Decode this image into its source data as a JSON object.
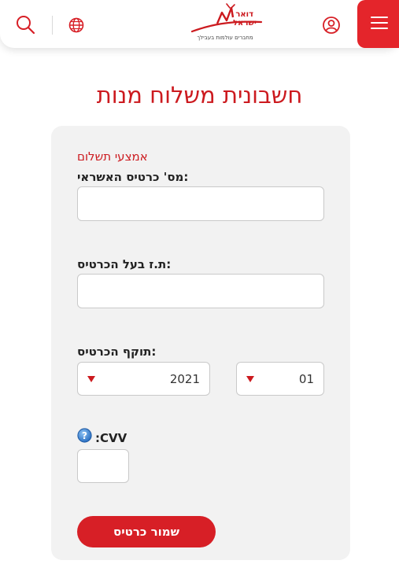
{
  "header": {
    "logo_text_line1": "דואר",
    "logo_text_line2": "ישראל",
    "logo_tagline": "מחברים עולמות בעבילך",
    "icons": {
      "search": "search-icon",
      "language": "globe-icon",
      "account": "user-icon",
      "menu": "hamburger-icon"
    }
  },
  "page": {
    "title": "חשבונית משלוח מנות"
  },
  "form": {
    "section_label": "אמצעי תשלום",
    "card_number_label": "מס' כרטיס האשראי:",
    "card_number_value": "",
    "owner_id_label": "ת.ז בעל הכרטיס:",
    "owner_id_value": "",
    "expiry_label": "תוקף הכרטיס:",
    "expiry_year": "2021",
    "expiry_month": "01",
    "cvv_label": ":CVV",
    "cvv_value": "",
    "help_icon": "question-circle-icon",
    "save_button": "שמור כרטיס"
  },
  "colors": {
    "brand_red": "#cc1a1f",
    "button_red": "#d71f26",
    "menu_red": "#e4252b",
    "card_bg": "#f2f2f2"
  }
}
